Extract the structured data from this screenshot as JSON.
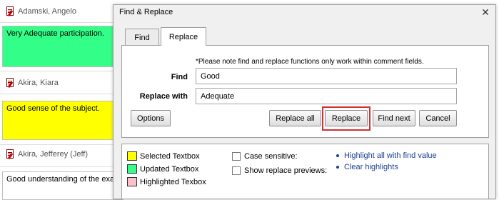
{
  "students": [
    {
      "name": "Adamski, Angelo",
      "comment": "Very Adequate participation.",
      "color": "#33ff88"
    },
    {
      "name": "Akira, Kiara",
      "comment": "Good sense of the subject.",
      "color": "#ffff00"
    },
    {
      "name": "Akira, Jefferey (Jeff)",
      "comment": "Good understanding of the exa",
      "color": "#ffffff"
    }
  ],
  "dialog": {
    "title": "Find & Replace",
    "close_icon": "close-icon",
    "tabs": [
      {
        "label": "Find"
      },
      {
        "label": "Replace",
        "active": true
      }
    ],
    "note": "*Please note find and replace functions only work within comment fields.",
    "find_label": "Find",
    "find_value": "Good",
    "replace_label": "Replace with",
    "replace_value": "Adequate",
    "buttons": {
      "options": "Options",
      "replace_all": "Replace all",
      "replace": "Replace",
      "find_next": "Find next",
      "cancel": "Cancel"
    },
    "highlight_color": "#d32f2f"
  },
  "legend": {
    "items": [
      {
        "label": "Selected Textbox",
        "color": "#ffff00"
      },
      {
        "label": "Updated Textbox",
        "color": "#33ff88"
      },
      {
        "label": "Highlighted Texbox",
        "color": "#ffc0cb"
      }
    ],
    "checkboxes": [
      {
        "label": "Case sensitive:",
        "checked": false
      },
      {
        "label": "Show replace previews:",
        "checked": false
      }
    ],
    "links": [
      {
        "label": "Highlight all with find value"
      },
      {
        "label": "Clear highlights"
      }
    ]
  }
}
